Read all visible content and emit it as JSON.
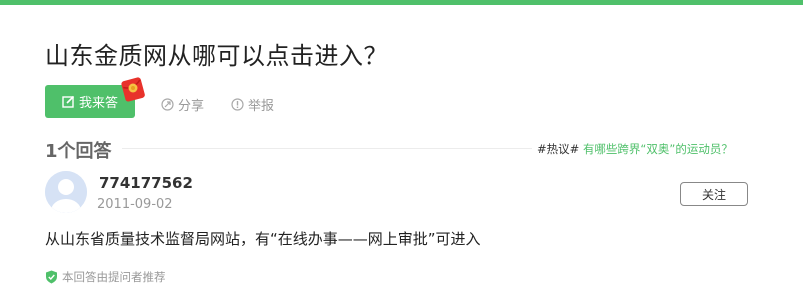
{
  "question": {
    "title": "山东金质网从哪可以点击进入？"
  },
  "actions": {
    "answer_label": "我来答",
    "share_label": "分享",
    "report_label": "举报"
  },
  "answers_section": {
    "count_label": "1个回答",
    "hot_tag": "#热议#",
    "hot_link": "有哪些跨界“双奥”的运动员？"
  },
  "answer": {
    "username": "774177562",
    "date": "2011-09-02",
    "follow_label": "关注",
    "text": "从山东省质量技术监督局网站，有“在线办事——网上审批”可进入",
    "recommend_note": "本回答由提问者推荐"
  },
  "colors": {
    "brand_green": "#4fc06a",
    "muted_text": "#999999"
  },
  "icons": [
    "edit-icon",
    "red-packet-icon",
    "share-icon",
    "report-icon",
    "avatar-icon",
    "shield-check-icon"
  ]
}
